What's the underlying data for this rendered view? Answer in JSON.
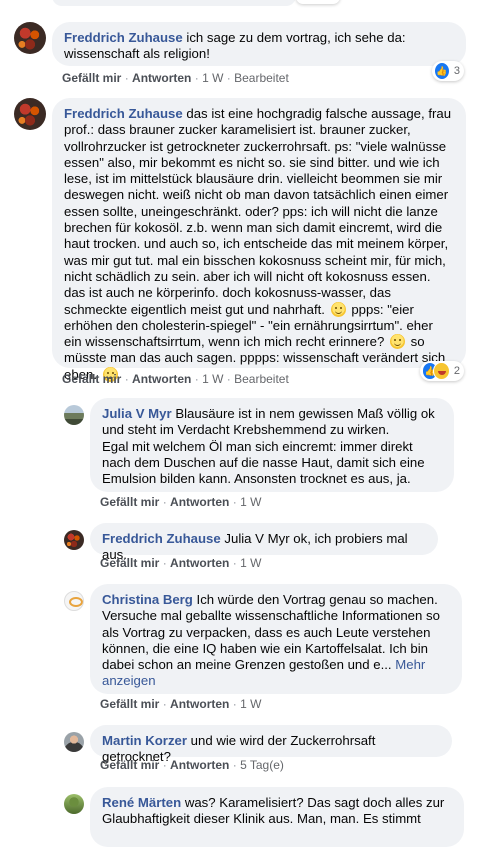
{
  "comments": [
    {
      "author": "Freddrich Zuhause",
      "text": "ich sage zu dem vortrag, ich sehe da: wissenschaft als religion!",
      "like": "Gefällt mir",
      "reply": "Antworten",
      "time": "1 W",
      "edited": "Bearbeitet",
      "reaction_count": "3"
    },
    {
      "author": "Freddrich Zuhause",
      "text": "das ist eine hochgradig falsche aussage, frau prof.: dass brauner zucker karamelisiert ist. brauner zucker, vollrohrzucker ist getrockneter zuckerrohrsaft. ps: \"viele walnüsse essen\" also, mir bekommt es nicht so. sie sind bitter. und wie ich lese, ist im mittelstück blausäure drin. vielleicht beommen sie mir deswegen nicht. weiß nicht ob man davon tatsächlich einen eimer essen sollte, uneingeschränkt. oder? pps: ich will nicht die lanze brechen für kokosöl. z.b. wenn man sich damit eincremt, wird die haut trocken. und auch so, ich entscheide das mit meinem körper, was mir gut tut. mal ein bisschen kokosnuss scheint mir, für mich, nicht schädlich zu sein. aber ich will nicht oft kokosnuss essen. das ist auch ne körperinfo. doch kokosnuss-wasser, das schmeckte eigentlich meist gut und nahrhaft.",
      "text_2": "ppps: \"eier erhöhen den cholesterin-spiegel\" - \"ein ernährungsirrtum\". eher ein wissenschaftsirrtum, wenn ich mich recht erinnere?",
      "text_3": "so müsste man das auch sagen. pppps: wissenschaft verändert sich eben.",
      "like": "Gefällt mir",
      "reply": "Antworten",
      "time": "1 W",
      "edited": "Bearbeitet",
      "reaction_count": "2"
    }
  ],
  "replies": [
    {
      "author": "Julia V Myr",
      "text": "Blausäure ist in nem gewissen Maß völlig ok und steht im Verdacht Krebshemmend zu wirken.",
      "text_2": "Egal mit welchem Öl man sich eincremt: immer direkt nach dem Duschen auf die nasse Haut, damit sich eine Emulsion bilden kann. Ansonsten trocknet es aus, ja.",
      "like": "Gefällt mir",
      "reply": "Antworten",
      "time": "1 W"
    },
    {
      "author": "Freddrich Zuhause",
      "text": "Julia V Myr ok, ich probiers mal aus.",
      "like": "Gefällt mir",
      "reply": "Antworten",
      "time": "1 W"
    },
    {
      "author": "Christina Berg",
      "text": "Ich würde den Vortrag genau so machen. Versuche mal geballte wissenschaftliche Informationen so als Vortrag zu verpacken, dass es auch Leute verstehen können, die eine IQ haben wie ein Kartoffelsalat. Ich bin dabei schon an meine Grenzen gestoßen und e...",
      "more": "Mehr anzeigen",
      "like": "Gefällt mir",
      "reply": "Antworten",
      "time": "1 W"
    },
    {
      "author": "Martin Korzer",
      "text": "und wie wird der Zuckerrohrsaft getrocknet?",
      "like": "Gefällt mir",
      "reply": "Antworten",
      "time": "5 Tag(e)"
    },
    {
      "author": "René Märten",
      "text": "was? Karamelisiert? Das sagt doch alles zur Glaubhaftigkeit dieser Klinik aus. Man, man. Es stimmt"
    }
  ],
  "separator": "·",
  "icons": {
    "like": "like-icon",
    "haha": "haha-icon",
    "smile": "smile-emoji"
  },
  "colors": {
    "author": "#385898",
    "bubble": "#f0f2f5",
    "meta": "#65676b",
    "like_blue": "#1877f2"
  }
}
